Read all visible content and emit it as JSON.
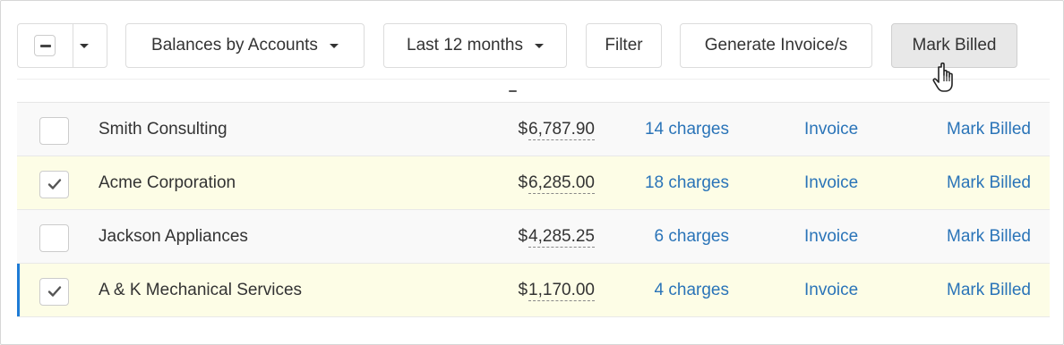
{
  "toolbar": {
    "group_by_label": "Balances by Accounts",
    "period_label": "Last 12 months",
    "filter_label": "Filter",
    "generate_label": "Generate Invoice/s",
    "mark_billed_label": "Mark Billed"
  },
  "accounts": [
    {
      "name": "Smith Consulting",
      "currency": "$",
      "amount": "6,787.90",
      "charges": "14 charges",
      "invoice_label": "Invoice",
      "mark_billed_label": "Mark Billed",
      "checked": false
    },
    {
      "name": "Acme Corporation",
      "currency": "$",
      "amount": "6,285.00",
      "charges": "18 charges",
      "invoice_label": "Invoice",
      "mark_billed_label": "Mark Billed",
      "checked": true
    },
    {
      "name": "Jackson Appliances",
      "currency": "$",
      "amount": "4,285.25",
      "charges": "6 charges",
      "invoice_label": "Invoice",
      "mark_billed_label": "Mark Billed",
      "checked": false
    },
    {
      "name": "A & K Mechanical Services",
      "currency": "$",
      "amount": "1,170.00",
      "charges": "4 charges",
      "invoice_label": "Invoice",
      "mark_billed_label": "Mark Billed",
      "checked": true
    }
  ],
  "colors": {
    "link": "#2a74b8",
    "selected_row": "#fdfde6",
    "focus_bar": "#1e7bd6"
  }
}
